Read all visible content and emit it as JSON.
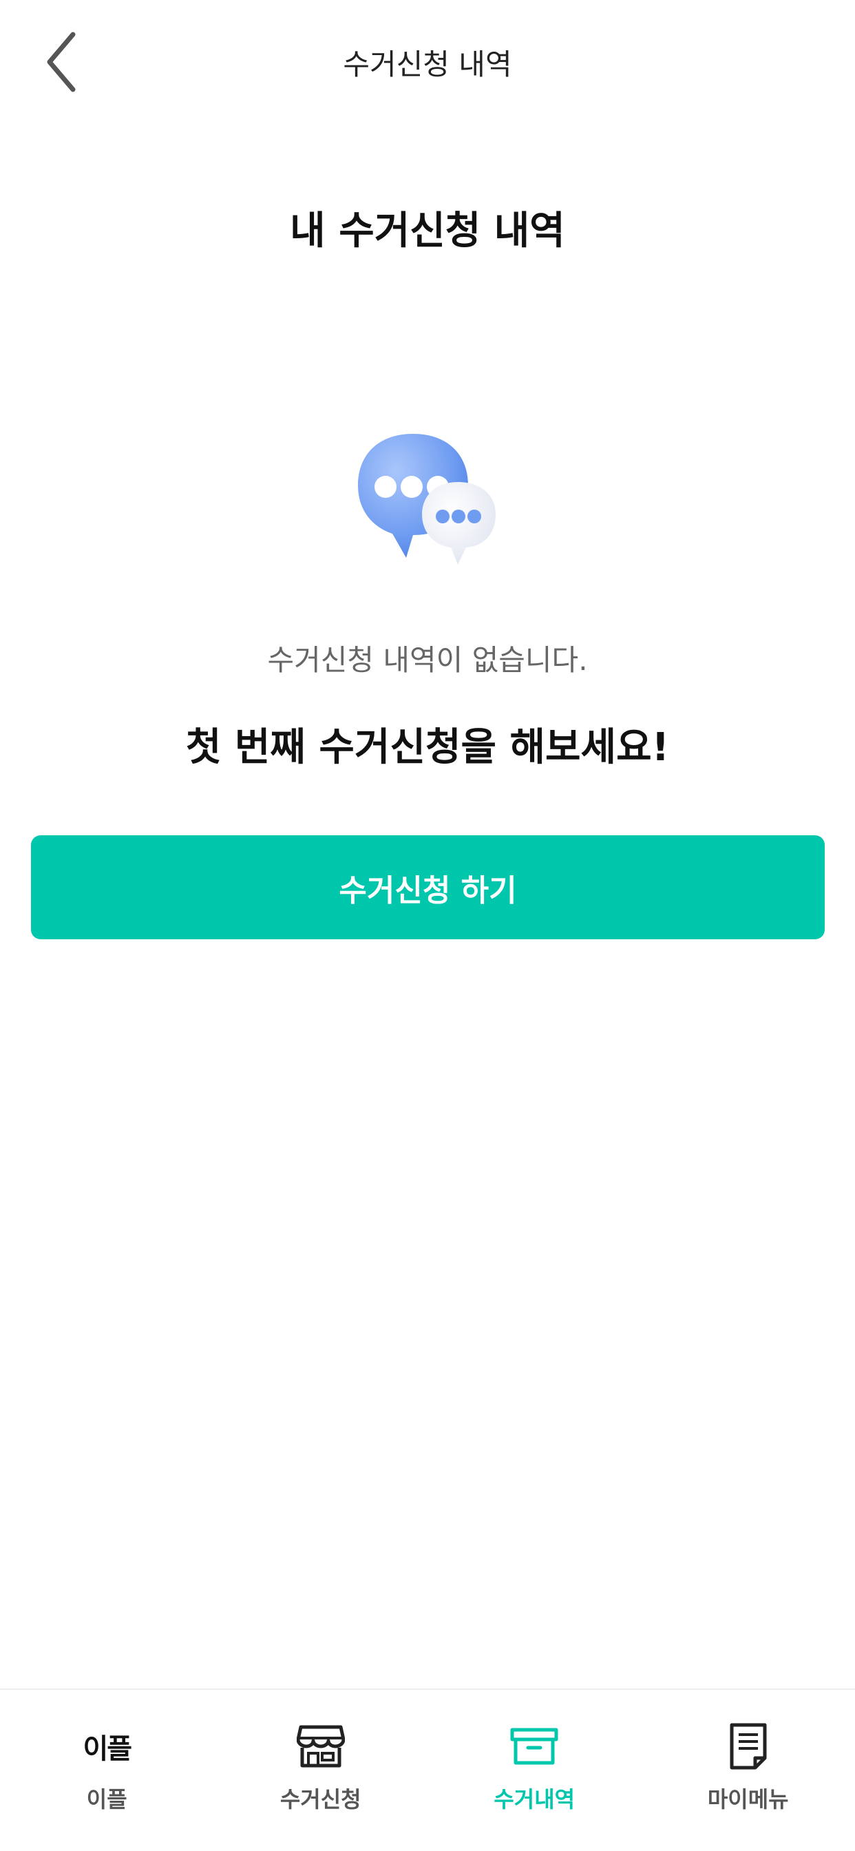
{
  "header": {
    "title": "수거신청 내역",
    "back_icon": "chevron-left-icon"
  },
  "main": {
    "page_title": "내 수거신청 내역",
    "illustration": "chat-bubbles-icon",
    "empty_message": "수거신청 내역이 없습니다.",
    "cta_message": "첫 번째 수거신청을 해보세요!",
    "primary_button_label": "수거신청 하기"
  },
  "bottom_nav": {
    "items": [
      {
        "label": "이플",
        "logo_text": "이플",
        "icon": "eple-logo-icon",
        "active": false
      },
      {
        "label": "수거신청",
        "icon": "store-icon",
        "active": false
      },
      {
        "label": "수거내역",
        "icon": "archive-box-icon",
        "active": true
      },
      {
        "label": "마이메뉴",
        "icon": "document-icon",
        "active": false
      }
    ]
  },
  "colors": {
    "accent": "#00c6ab",
    "bubble_blue": "#7aa6f5",
    "text_primary": "#111111",
    "text_secondary": "#666666"
  }
}
